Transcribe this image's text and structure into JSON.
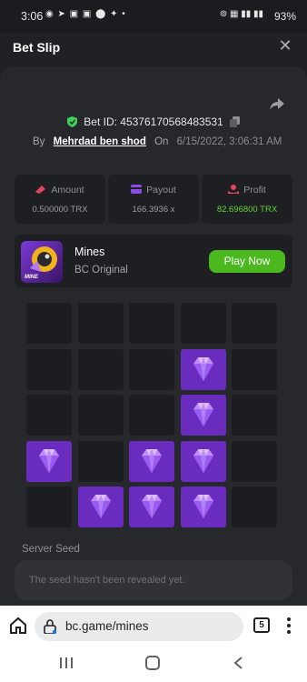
{
  "status_bar": {
    "time": "3:06",
    "notification_icons": [
      "whatsapp-icon",
      "telegram-icon",
      "message-icon",
      "facebook-icon",
      "facebook-icon",
      "twitter-icon",
      "dot-icon"
    ],
    "system_icons": "VoLTE 4G",
    "battery": "93%"
  },
  "sheet": {
    "title": "Bet Slip"
  },
  "bet": {
    "id_label": "Bet ID: 45376170568483531",
    "by_label": "By",
    "user": "Mehrdad ben shod",
    "on_label": "On",
    "date": "6/15/2022, 3:06:31 AM"
  },
  "stats": [
    {
      "label": "Amount",
      "value": "0.500000 TRX",
      "icon": "amount-icon"
    },
    {
      "label": "Payout",
      "value": "166.3936 x",
      "icon": "payout-icon"
    },
    {
      "label": "Profit",
      "value": "82.696800 TRX",
      "icon": "profit-icon"
    }
  ],
  "game": {
    "name": "Mines",
    "subtitle": "BC Original",
    "thumb_text": "MINE",
    "play_label": "Play Now"
  },
  "grid": {
    "rows": 5,
    "cols": 5,
    "gems": [
      [
        1,
        3
      ],
      [
        2,
        3
      ],
      [
        3,
        0
      ],
      [
        3,
        2
      ],
      [
        3,
        3
      ],
      [
        4,
        1
      ],
      [
        4,
        2
      ],
      [
        4,
        3
      ]
    ]
  },
  "seed": {
    "label": "Server Seed",
    "placeholder": "The seed hasn't been revealed yet."
  },
  "browser": {
    "url": "bc.game/mines",
    "tab_count": "5"
  },
  "colors": {
    "accent_green": "#4cb81f",
    "gem_purple": "#6a2bbf",
    "profit_green": "#64d23c"
  }
}
